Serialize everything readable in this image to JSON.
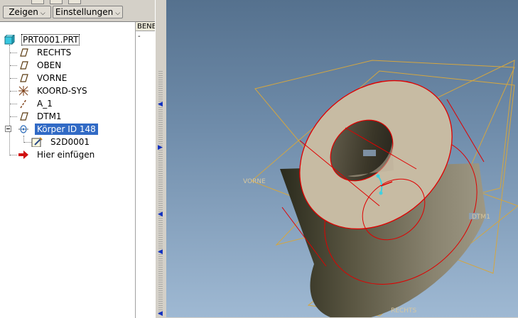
{
  "toolbar": {
    "show_label": "Zeigen",
    "settings_label": "Einstellungen"
  },
  "column_header": "BENE",
  "column_value": "-",
  "tree": {
    "root": "PRT0001.PRT",
    "items": [
      {
        "label": "RECHTS",
        "icon": "datum-plane-icon"
      },
      {
        "label": "OBEN",
        "icon": "datum-plane-icon"
      },
      {
        "label": "VORNE",
        "icon": "datum-plane-icon"
      },
      {
        "label": "KOORD-SYS",
        "icon": "coordinate-system-icon"
      },
      {
        "label": "A_1",
        "icon": "datum-axis-icon"
      },
      {
        "label": "DTM1",
        "icon": "datum-plane-icon"
      },
      {
        "label": "Körper ID 148",
        "icon": "revolve-feature-icon",
        "selected": true
      },
      {
        "label": "S2D0001",
        "icon": "sketch-icon"
      },
      {
        "label": "Hier einfügen",
        "icon": "insert-here-arrow-icon"
      }
    ]
  },
  "viewport": {
    "plane_labels": {
      "front": "VORNE",
      "right": "RECHTS",
      "dtm": "DTM1"
    },
    "colors": {
      "solid_top": "#c7bba3",
      "edge": "#e00000",
      "datum": "#d4a640",
      "selection": "#316ac5"
    }
  }
}
